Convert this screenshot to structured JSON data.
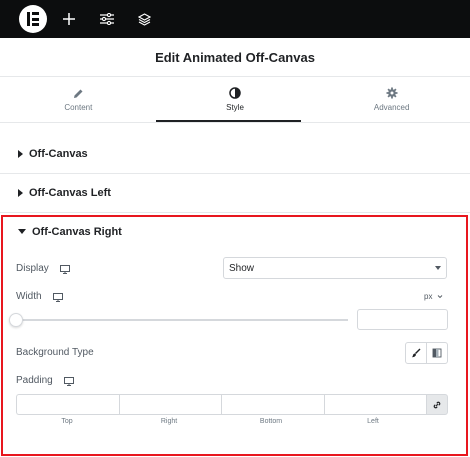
{
  "topbar": {
    "icons": [
      "elementor-logo-icon",
      "plus-icon",
      "sliders-icon",
      "layers-icon"
    ]
  },
  "header": {
    "title": "Edit Animated Off-Canvas"
  },
  "tabs": [
    {
      "label": "Content",
      "icon": "pencil-icon",
      "active": false
    },
    {
      "label": "Style",
      "icon": "contrast-icon",
      "active": true
    },
    {
      "label": "Advanced",
      "icon": "gear-icon",
      "active": false
    }
  ],
  "sections": [
    {
      "label": "Off-Canvas",
      "expanded": false
    },
    {
      "label": "Off-Canvas Left",
      "expanded": false
    },
    {
      "label": "Off-Canvas Right",
      "expanded": true
    }
  ],
  "controls": {
    "display": {
      "label": "Display",
      "value": "Show"
    },
    "width": {
      "label": "Width",
      "unit": "px",
      "value": ""
    },
    "background_type": {
      "label": "Background Type"
    },
    "padding": {
      "label": "Padding",
      "fields": [
        "Top",
        "Right",
        "Bottom",
        "Left"
      ]
    }
  },
  "colors": {
    "highlight": "#e8161e",
    "topbar": "#0c0d0e"
  }
}
